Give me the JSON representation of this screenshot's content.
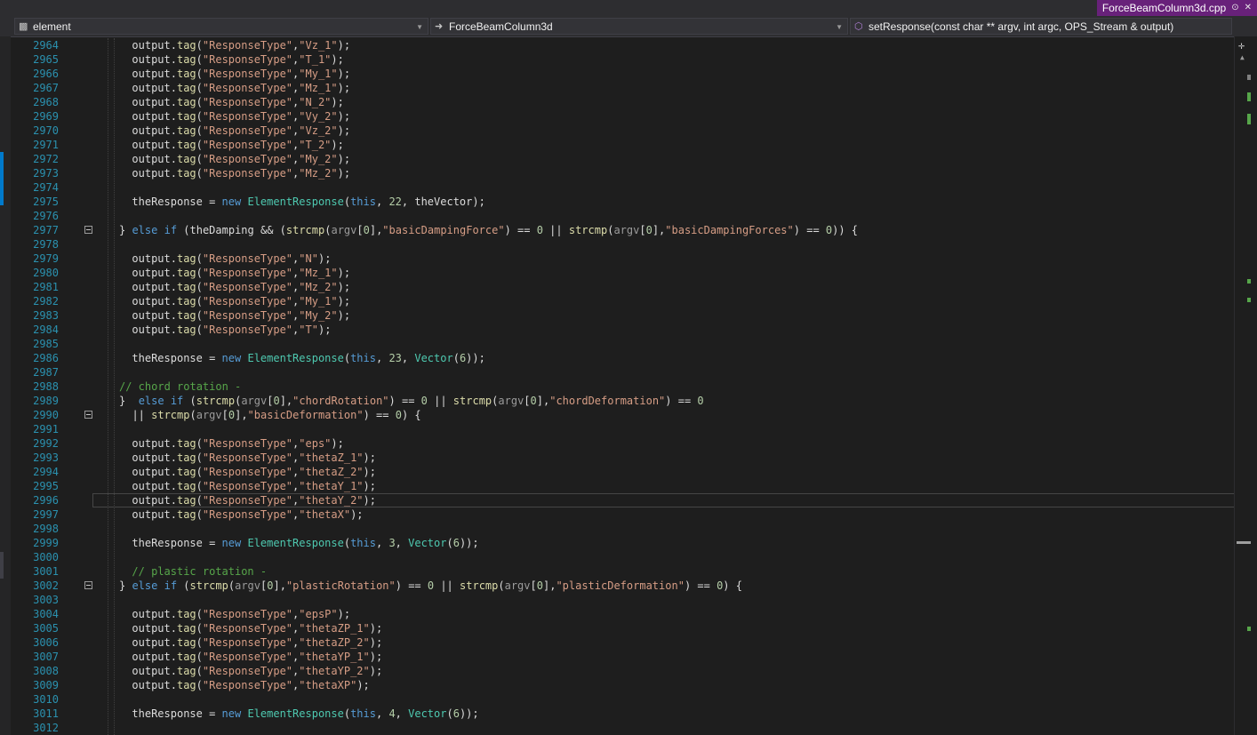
{
  "tab": {
    "filename": "ForceBeamColumn3d.cpp",
    "pin_icon": "pin-icon",
    "close_icon": "close-icon"
  },
  "navbar": {
    "project": {
      "label": "element",
      "icon": "project-icon"
    },
    "scope": {
      "label": "ForceBeamColumn3d",
      "icon": "arrow-right-icon"
    },
    "member": {
      "label": "setResponse(const char ** argv, int argc, OPS_Stream & output)",
      "icon": "cube-icon"
    }
  },
  "editor": {
    "current_line": "2996",
    "lines": [
      {
        "n": "2964",
        "t": "output.tag(\"ResponseType\",\"Vz_1\");"
      },
      {
        "n": "2965",
        "t": "output.tag(\"ResponseType\",\"T_1\");"
      },
      {
        "n": "2966",
        "t": "output.tag(\"ResponseType\",\"My_1\");"
      },
      {
        "n": "2967",
        "t": "output.tag(\"ResponseType\",\"Mz_1\");"
      },
      {
        "n": "2968",
        "t": "output.tag(\"ResponseType\",\"N_2\");"
      },
      {
        "n": "2969",
        "t": "output.tag(\"ResponseType\",\"Vy_2\");"
      },
      {
        "n": "2970",
        "t": "output.tag(\"ResponseType\",\"Vz_2\");"
      },
      {
        "n": "2971",
        "t": "output.tag(\"ResponseType\",\"T_2\");"
      },
      {
        "n": "2972",
        "t": "output.tag(\"ResponseType\",\"My_2\");"
      },
      {
        "n": "2973",
        "t": "output.tag(\"ResponseType\",\"Mz_2\");"
      },
      {
        "n": "2974",
        "t": ""
      },
      {
        "n": "2975",
        "t": "theResponse = new ElementResponse(this, 22, theVector);"
      },
      {
        "n": "2976",
        "t": ""
      },
      {
        "n": "2977",
        "t": "} else if (theDamping && (strcmp(argv[0],\"basicDampingForce\") == 0 || strcmp(argv[0],\"basicDampingForces\") == 0)) {"
      },
      {
        "n": "2978",
        "t": ""
      },
      {
        "n": "2979",
        "t": "output.tag(\"ResponseType\",\"N\");"
      },
      {
        "n": "2980",
        "t": "output.tag(\"ResponseType\",\"Mz_1\");"
      },
      {
        "n": "2981",
        "t": "output.tag(\"ResponseType\",\"Mz_2\");"
      },
      {
        "n": "2982",
        "t": "output.tag(\"ResponseType\",\"My_1\");"
      },
      {
        "n": "2983",
        "t": "output.tag(\"ResponseType\",\"My_2\");"
      },
      {
        "n": "2984",
        "t": "output.tag(\"ResponseType\",\"T\");"
      },
      {
        "n": "2985",
        "t": ""
      },
      {
        "n": "2986",
        "t": "theResponse = new ElementResponse(this, 23, Vector(6));"
      },
      {
        "n": "2987",
        "t": ""
      },
      {
        "n": "2988",
        "t": "// chord rotation -"
      },
      {
        "n": "2989",
        "t": "}  else if (strcmp(argv[0],\"chordRotation\") == 0 || strcmp(argv[0],\"chordDeformation\") == 0"
      },
      {
        "n": "2990",
        "t": "  || strcmp(argv[0],\"basicDeformation\") == 0) {"
      },
      {
        "n": "2991",
        "t": ""
      },
      {
        "n": "2992",
        "t": "output.tag(\"ResponseType\",\"eps\");"
      },
      {
        "n": "2993",
        "t": "output.tag(\"ResponseType\",\"thetaZ_1\");"
      },
      {
        "n": "2994",
        "t": "output.tag(\"ResponseType\",\"thetaZ_2\");"
      },
      {
        "n": "2995",
        "t": "output.tag(\"ResponseType\",\"thetaY_1\");"
      },
      {
        "n": "2996",
        "t": "output.tag(\"ResponseType\",\"thetaY_2\");"
      },
      {
        "n": "2997",
        "t": "output.tag(\"ResponseType\",\"thetaX\");"
      },
      {
        "n": "2998",
        "t": ""
      },
      {
        "n": "2999",
        "t": "theResponse = new ElementResponse(this, 3, Vector(6));"
      },
      {
        "n": "3000",
        "t": ""
      },
      {
        "n": "3001",
        "t": "// plastic rotation -"
      },
      {
        "n": "3002",
        "t": "} else if (strcmp(argv[0],\"plasticRotation\") == 0 || strcmp(argv[0],\"plasticDeformation\") == 0) {"
      },
      {
        "n": "3003",
        "t": ""
      },
      {
        "n": "3004",
        "t": "output.tag(\"ResponseType\",\"epsP\");"
      },
      {
        "n": "3005",
        "t": "output.tag(\"ResponseType\",\"thetaZP_1\");"
      },
      {
        "n": "3006",
        "t": "output.tag(\"ResponseType\",\"thetaZP_2\");"
      },
      {
        "n": "3007",
        "t": "output.tag(\"ResponseType\",\"thetaYP_1\");"
      },
      {
        "n": "3008",
        "t": "output.tag(\"ResponseType\",\"thetaYP_2\");"
      },
      {
        "n": "3009",
        "t": "output.tag(\"ResponseType\",\"thetaXP\");"
      },
      {
        "n": "3010",
        "t": ""
      },
      {
        "n": "3011",
        "t": "theResponse = new ElementResponse(this, 4, Vector(6));"
      },
      {
        "n": "3012",
        "t": ""
      }
    ]
  },
  "colors": {
    "background": "#1e1e1e",
    "tab_active": "#68217a",
    "line_number": "#2b91af",
    "keyword": "#569cd6",
    "string": "#d69d85",
    "function": "#dcdcaa",
    "type": "#4ec9b0",
    "comment": "#57a64a",
    "number": "#b5cea8",
    "change_marker": "#57a64a"
  }
}
